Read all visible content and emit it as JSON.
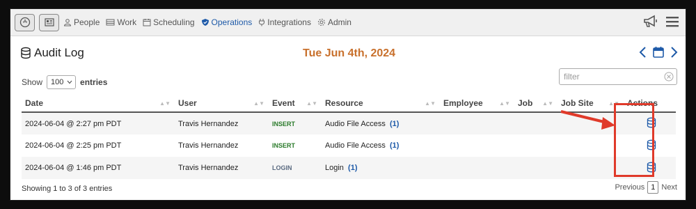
{
  "nav": {
    "items": [
      {
        "label": "People",
        "icon": "person-icon"
      },
      {
        "label": "Work",
        "icon": "work-icon"
      },
      {
        "label": "Scheduling",
        "icon": "calendar-icon"
      },
      {
        "label": "Operations",
        "icon": "shield-icon",
        "active": true
      },
      {
        "label": "Integrations",
        "icon": "plug-icon"
      },
      {
        "label": "Admin",
        "icon": "gear-icon"
      }
    ]
  },
  "page": {
    "title": "Audit Log",
    "date": "Tue Jun 4th, 2024"
  },
  "controls": {
    "show_label": "Show",
    "entries_value": "100",
    "entries_label": "entries",
    "filter_placeholder": "filter"
  },
  "table": {
    "columns": [
      "Date",
      "User",
      "Event",
      "Resource",
      "Employee",
      "Job",
      "Job Site",
      "Actions"
    ],
    "rows": [
      {
        "date": "2024-06-04 @ 2:27 pm PDT",
        "user": "Travis Hernandez",
        "event": "INSERT",
        "resource": "Audio File Access",
        "count": "(1)"
      },
      {
        "date": "2024-06-04 @ 2:25 pm PDT",
        "user": "Travis Hernandez",
        "event": "INSERT",
        "resource": "Audio File Access",
        "count": "(1)"
      },
      {
        "date": "2024-06-04 @ 1:46 pm PDT",
        "user": "Travis Hernandez",
        "event": "LOGIN",
        "resource": "Login",
        "count": "(1)"
      }
    ]
  },
  "footer": {
    "info": "Showing 1 to 3 of 3 entries",
    "previous": "Previous",
    "page": "1",
    "next": "Next"
  },
  "colors": {
    "accent": "#1e5aa8",
    "date": "#c8702c",
    "insert": "#2a7a2a",
    "annotation": "#e03a2a"
  }
}
